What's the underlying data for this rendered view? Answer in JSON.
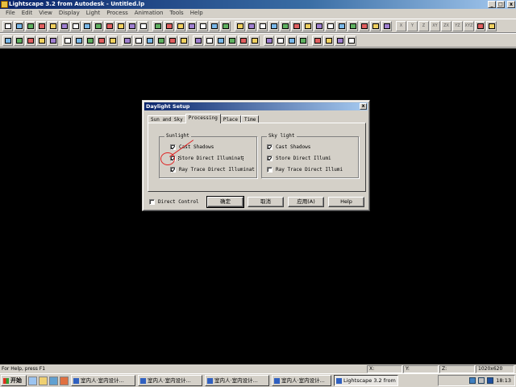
{
  "window": {
    "title": "Lightscape 3.2 from Autodesk - Untitled.lp",
    "controls": [
      "_",
      "□",
      "x"
    ]
  },
  "menu": [
    "File",
    "Edit",
    "View",
    "Display",
    "Light",
    "Process",
    "Animation",
    "Tools",
    "Help"
  ],
  "toolbar1": {
    "left_buttons": 13,
    "mid_buttons": 7,
    "right_buttons": 14,
    "axis_labels": [
      "X",
      "Y",
      "Z",
      "XY",
      "ZX",
      "YZ",
      "XYZ"
    ]
  },
  "toolbar2": {
    "buttons": 30
  },
  "dialog": {
    "title": "Daylight Setup",
    "close": "x",
    "tabs": [
      "Sun and Sky",
      "Processing",
      "Place",
      "Time"
    ],
    "active_tab": "Processing",
    "sunlight": {
      "label": "Sunlight",
      "options": [
        {
          "label": "Cast Shadows",
          "checked": true
        },
        {
          "label": "Store Direct Illuminat",
          "checked": true
        },
        {
          "label": "Ray Trace Direct Illuminat",
          "checked": true
        }
      ]
    },
    "skylight": {
      "label": "Sky light",
      "options": [
        {
          "label": "Cast Shadows",
          "checked": true
        },
        {
          "label": "Store Direct Illumi",
          "checked": true
        },
        {
          "label": "Ray Trace Direct Illumi",
          "checked": false
        }
      ]
    },
    "direct_control": {
      "label": "Direct Control",
      "checked": false
    },
    "buttons": {
      "ok": "确定",
      "cancel": "取消",
      "apply": "应用(A)",
      "help": "Help"
    }
  },
  "statusbar": {
    "message": "For Help, press F1",
    "x_label": "X:",
    "y_label": "Y:",
    "z_label": "Z:",
    "resolution": "1020x620"
  },
  "taskbar": {
    "start": "开始",
    "items": [
      "室内人·室内设计...",
      "室内人·室内设计...",
      "室内人·室内设计...",
      "室内人·室内设计...",
      "Lightscape 3.2 from ..."
    ],
    "active_index": 4,
    "clock": "18:13"
  },
  "colors": {
    "titlebar": "#0a246a",
    "canvas": "#000000",
    "annotation": "#e02020"
  }
}
